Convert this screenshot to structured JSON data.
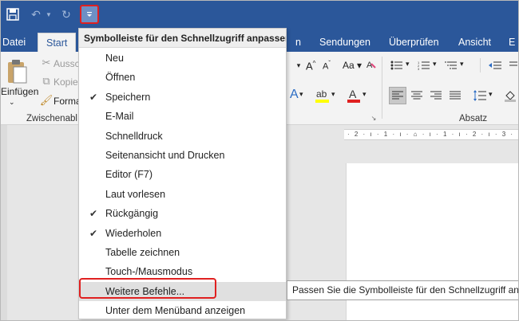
{
  "quick_access": {
    "save_icon": "save-icon",
    "undo_icon": "undo-icon",
    "redo_icon": "redo-icon",
    "customize_icon": "customize-dropdown-icon"
  },
  "tabs": [
    "Datei",
    "Start",
    "n",
    "Sendungen",
    "Überprüfen",
    "Ansicht",
    "E"
  ],
  "ribbon": {
    "paste_label": "Einfügen",
    "cut_label": "Aussc",
    "copy_label": "Kopie",
    "format_label": "Forma",
    "clipboard_group": "Zwischenabl",
    "paragraph_group": "Absatz"
  },
  "ruler_text": "· 2 · ı · 1 · ı · ⌂ · ı · 1 · ı · 2 · ı · 3 · ı",
  "menu": {
    "header": "Symbolleiste für den Schnellzugriff anpassen",
    "items": [
      {
        "label": "Neu",
        "checked": false
      },
      {
        "label": "Öffnen",
        "checked": false
      },
      {
        "label": "Speichern",
        "checked": true
      },
      {
        "label": "E-Mail",
        "checked": false
      },
      {
        "label": "Schnelldruck",
        "checked": false
      },
      {
        "label": "Seitenansicht und Drucken",
        "checked": false
      },
      {
        "label": "Editor (F7)",
        "checked": false
      },
      {
        "label": "Laut vorlesen",
        "checked": false
      },
      {
        "label": "Rückgängig",
        "checked": true
      },
      {
        "label": "Wiederholen",
        "checked": true
      },
      {
        "label": "Tabelle zeichnen",
        "checked": false
      },
      {
        "label": "Touch-/Mausmodus",
        "checked": false
      },
      {
        "label": "Weitere Befehle...",
        "checked": false
      },
      {
        "label": "Unter dem Menüband anzeigen",
        "checked": false
      }
    ]
  },
  "tooltip": "Passen Sie die Symbolleiste für den Schnellzugriff an.",
  "colors": {
    "title_bar": "#2b579a",
    "highlight_border": "#e02020",
    "ribbon_bg": "#f3f3f3"
  }
}
